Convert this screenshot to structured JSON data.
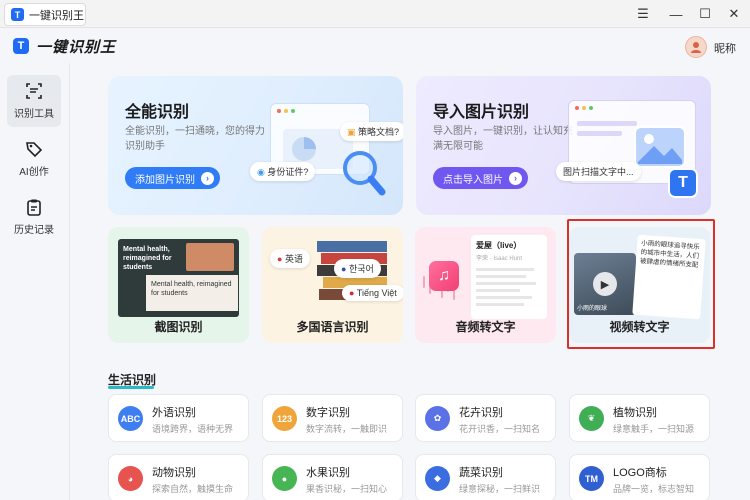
{
  "window": {
    "tab_title": "一键识别王",
    "controls": [
      "☰",
      "—",
      "☐",
      "✕"
    ]
  },
  "header": {
    "app_title": "一键识别王",
    "nickname": "昵称"
  },
  "sidebar": {
    "items": [
      {
        "label": "识别工具",
        "active": true
      },
      {
        "label": "AI创作",
        "active": false
      },
      {
        "label": "历史记录",
        "active": false
      }
    ]
  },
  "feature_cards": [
    {
      "title": "全能识别",
      "desc": "全能识别，一扫通晓，您的得力识别助手",
      "button": "添加图片识别",
      "pill_a": "策略文档?",
      "pill_b": "身份证件?"
    },
    {
      "title": "导入图片识别",
      "desc": "导入图片，一键识别，让认知充满无限可能",
      "button": "点击导入图片",
      "pill_a": "图片扫描文字中..."
    }
  ],
  "mode_cards": [
    {
      "label": "截图识别",
      "preview_a": "Mental health, reimagined for students",
      "preview_b": "Mental health, reimagined for students"
    },
    {
      "label": "多国语言识别",
      "tags": [
        "英语",
        "한국어",
        "Tiếng Việt"
      ]
    },
    {
      "label": "音频转文字",
      "song_title": "爱屋（live）",
      "song_meta": "李荣 · Isaac Hunt"
    },
    {
      "label": "视频转文字",
      "note": "小雨的眼球追寻快乐的城市中生活，人们被肆虐的情绪所支配",
      "video_caption": "小雨的眼球"
    }
  ],
  "section": {
    "title": "生活识别"
  },
  "tools": [
    {
      "name": "外语识别",
      "desc": "语境跨界，语种无界",
      "icon_text": "ABC",
      "color": "#3f7ef0"
    },
    {
      "name": "数字识别",
      "desc": "数字流转，一触即识",
      "icon_text": "123",
      "color": "#f0a53a"
    },
    {
      "name": "花卉识别",
      "desc": "花开识香，一扫知名",
      "icon_text": "✿",
      "color": "#5b72e6"
    },
    {
      "name": "植物识别",
      "desc": "绿意触手，一扫知源",
      "icon_text": "❦",
      "color": "#3fae54"
    },
    {
      "name": "动物识别",
      "desc": "探索自然，触摸生命",
      "icon_text": "◕",
      "color": "#e7534f"
    },
    {
      "name": "水果识别",
      "desc": "果香识秘，一扫知心",
      "icon_text": "●",
      "color": "#47b553"
    },
    {
      "name": "蔬菜识别",
      "desc": "绿意探秘，一扫鲜识",
      "icon_text": "◆",
      "color": "#3b6de0"
    },
    {
      "name": "LOGO商标",
      "desc": "品牌一览，标志智知",
      "icon_text": "TM",
      "color": "#2f5fd0"
    }
  ],
  "colors": {
    "accent": "#2f7cf6",
    "accent_purple": "#6f57f0",
    "highlight": "#d9302a"
  }
}
